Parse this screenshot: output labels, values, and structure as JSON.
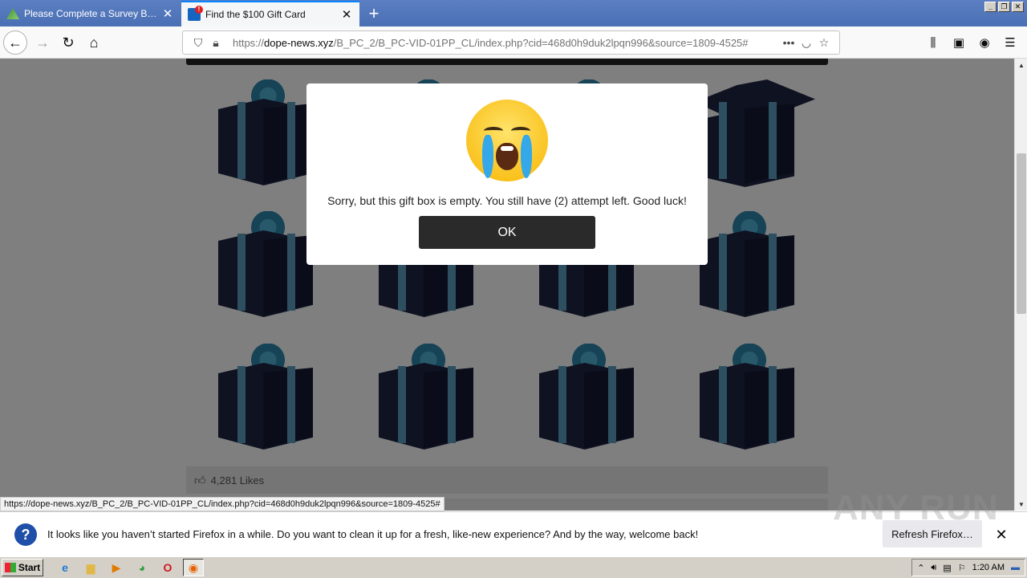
{
  "tabs": [
    {
      "title": "Please Complete a Survey Below b",
      "favicon": "survey-icon"
    },
    {
      "title": "Find the $100 Gift Card",
      "favicon": "gift-icon"
    }
  ],
  "nav": {
    "url_prefix": "https://",
    "url_host": "dope-news.xyz",
    "url_path": "/B_PC_2/B_PC-VID-01PP_CL/index.php?cid=468d0h9duk2lpqn996&source=1809-4525#"
  },
  "dialog": {
    "message": "Sorry, but this gift box is empty. You still have (2) attempt left. Good luck!",
    "ok_label": "OK"
  },
  "page": {
    "likes": "4,281 Likes"
  },
  "status_url": "https://dope-news.xyz/B_PC_2/B_PC-VID-01PP_CL/index.php?cid=468d0h9duk2lpqn996&source=1809-4525#",
  "notification": {
    "message": "It looks like you haven’t started Firefox in a while. Do you want to clean it up for a fresh, like-new experience? And by the way, welcome back!",
    "refresh_label": "Refresh Firefox…"
  },
  "watermark": "ANY RUN",
  "taskbar": {
    "start_label": "Start",
    "clock": "1:20 AM"
  },
  "colors": {
    "accent": "#0a84ff",
    "gift_box": "#1c2442",
    "ribbon": "#5a9fc0"
  }
}
